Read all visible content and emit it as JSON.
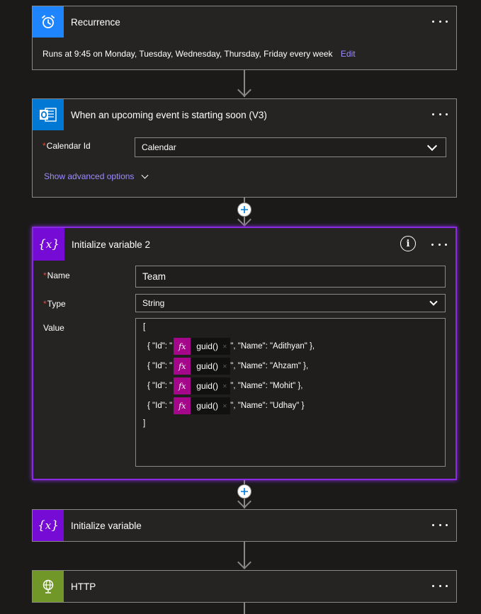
{
  "recurrence": {
    "title": "Recurrence",
    "summary": "Runs at 9:45 on Monday, Tuesday, Wednesday, Thursday, Friday every week",
    "edit_label": "Edit"
  },
  "calendar_event": {
    "title": "When an upcoming event is starting soon (V3)",
    "calendar_id_label": "Calendar Id",
    "calendar_id_value": "Calendar",
    "advanced_options_label": "Show advanced options"
  },
  "init_var_2": {
    "title": "Initialize variable 2",
    "name_label": "Name",
    "name_value": "Team",
    "type_label": "Type",
    "type_value": "String",
    "value_label": "Value",
    "value_open": "[",
    "value_close": "]",
    "entries": [
      {
        "prefix": "{ \"Id\": \"",
        "func": "guid()",
        "suffix": "\", \"Name\": \"Adithyan\" },"
      },
      {
        "prefix": "{ \"Id\": \"",
        "func": "guid()",
        "suffix": "\", \"Name\": \"Ahzam\" },"
      },
      {
        "prefix": "{ \"Id\": \"",
        "func": "guid()",
        "suffix": "\", \"Name\": \"Mohit\" },"
      },
      {
        "prefix": "{ \"Id\": \"",
        "func": "guid()",
        "suffix": "\", \"Name\": \"Udhay\" }"
      }
    ],
    "fx_symbol": "fx"
  },
  "init_var": {
    "title": "Initialize variable"
  },
  "http": {
    "title": "HTTP"
  },
  "colors": {
    "recurrence_icon_bg": "#1f85ff",
    "outlook_icon_bg": "#0078d4",
    "variable_icon_bg": "#770bd6",
    "http_icon_bg": "#709727",
    "link": "#9c8cff",
    "expression_token": "#a4078a"
  },
  "icons": [
    "alarm-clock-icon",
    "outlook-icon",
    "variable-icon",
    "globe-icon",
    "info-icon",
    "more-options-icon",
    "chevron-down-icon",
    "plus-icon"
  ]
}
